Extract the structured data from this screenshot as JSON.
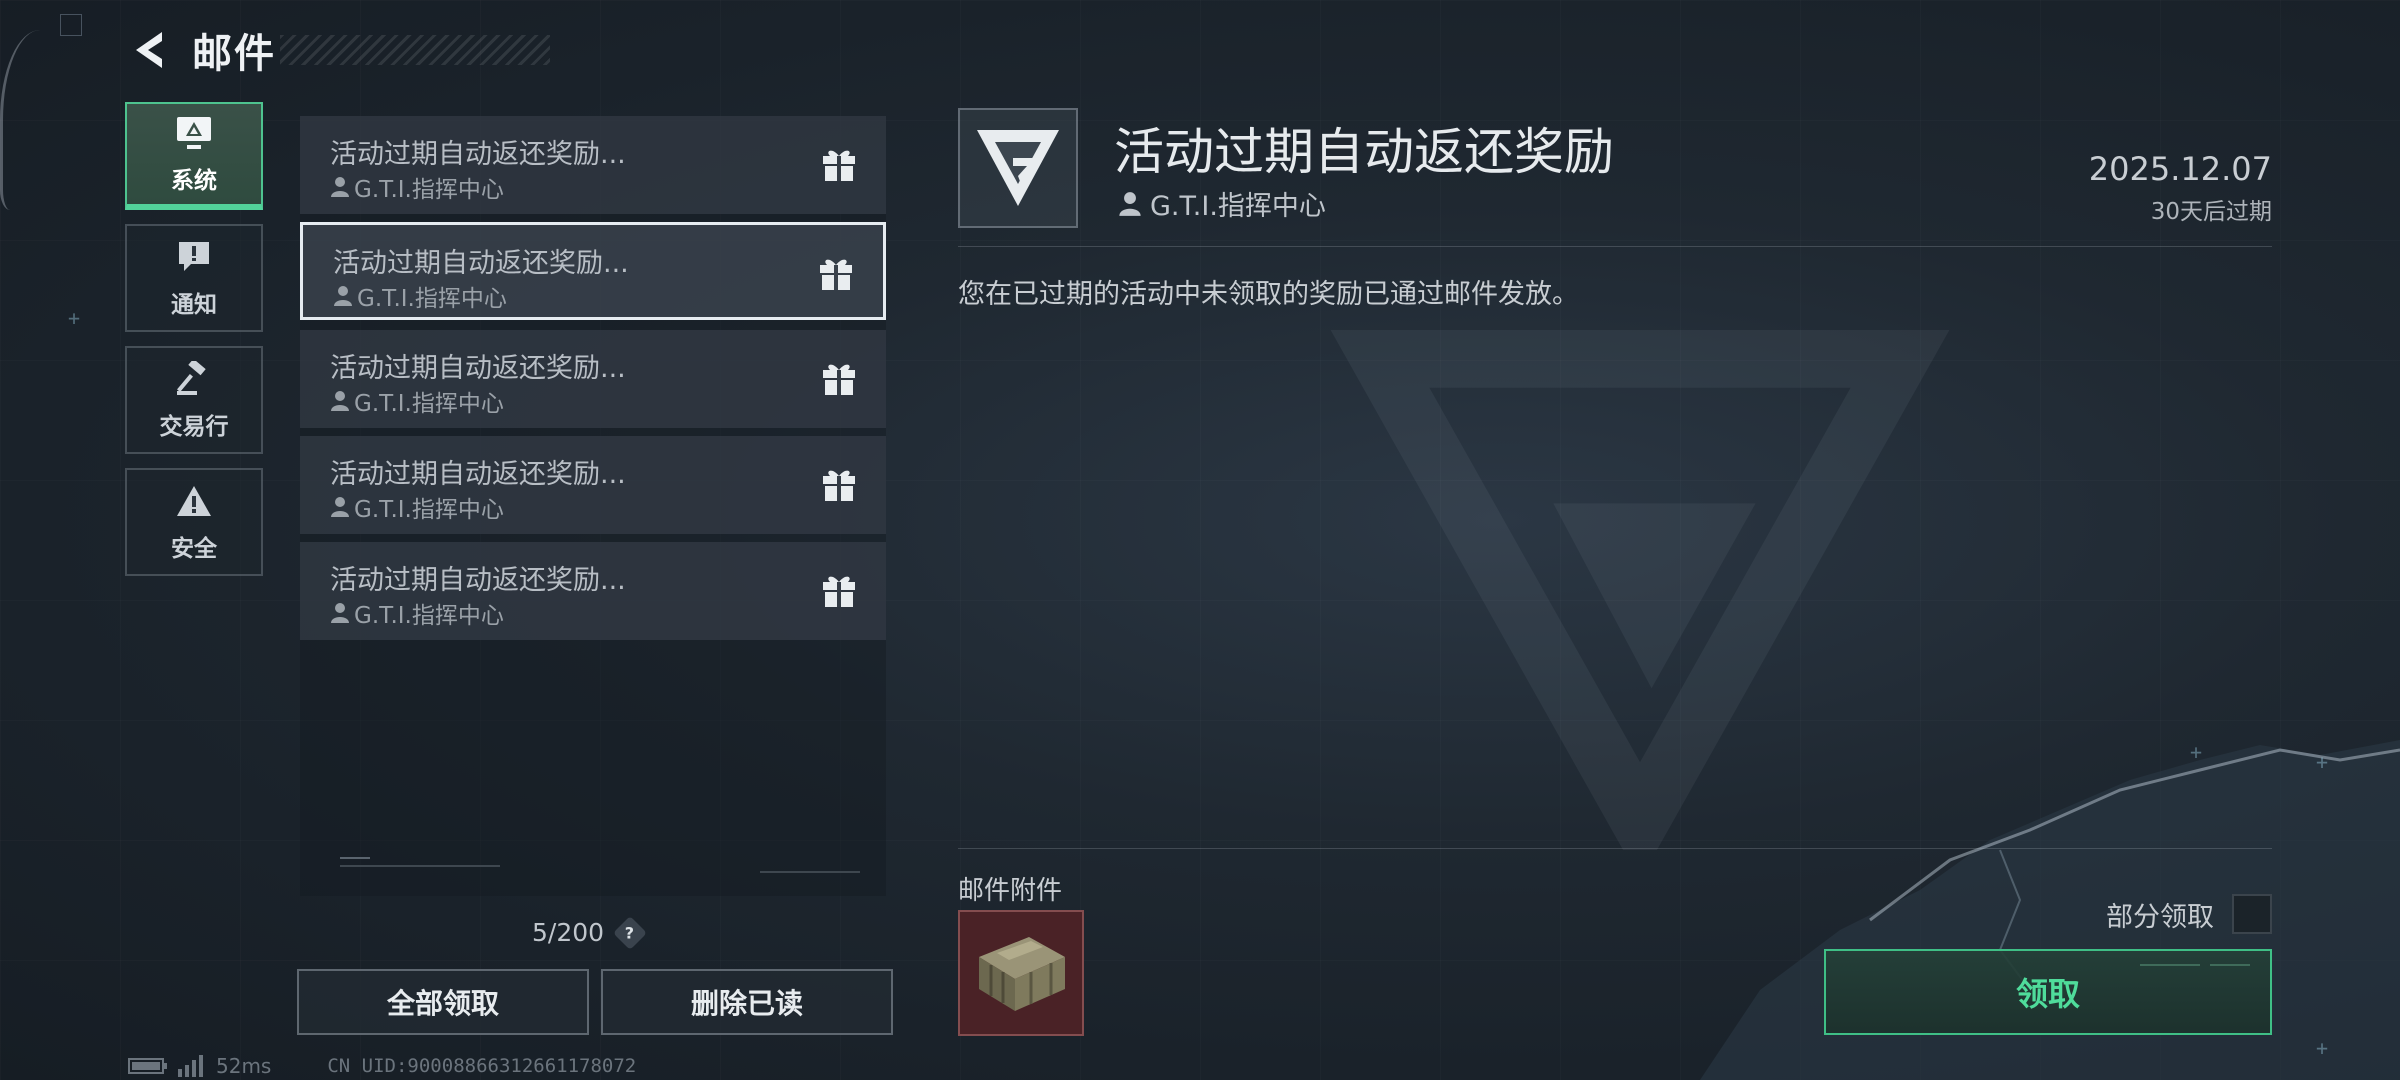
{
  "header": {
    "title": "邮件",
    "back_icon": "back-arrow-icon"
  },
  "categories": [
    {
      "label": "系统",
      "icon": "monitor-icon",
      "active": true
    },
    {
      "label": "通知",
      "icon": "alert-bubble-icon",
      "active": false
    },
    {
      "label": "交易行",
      "icon": "gavel-icon",
      "active": false
    },
    {
      "label": "安全",
      "icon": "warning-icon",
      "active": false
    }
  ],
  "mails": [
    {
      "subject": "活动过期自动返还奖励...",
      "sender": "G.T.I.指挥中心",
      "icon": "gift-icon",
      "selected": false
    },
    {
      "subject": "活动过期自动返还奖励...",
      "sender": "G.T.I.指挥中心",
      "icon": "gift-icon",
      "selected": true
    },
    {
      "subject": "活动过期自动返还奖励...",
      "sender": "G.T.I.指挥中心",
      "icon": "gift-icon",
      "selected": false
    },
    {
      "subject": "活动过期自动返还奖励...",
      "sender": "G.T.I.指挥中心",
      "icon": "gift-icon",
      "selected": false
    },
    {
      "subject": "活动过期自动返还奖励...",
      "sender": "G.T.I.指挥中心",
      "icon": "gift-icon",
      "selected": false
    }
  ],
  "mail_count": "5/200",
  "help_symbol": "?",
  "actions": {
    "claim_all": "全部领取",
    "delete_read": "删除已读"
  },
  "status": {
    "ping": "52ms",
    "uid": "CN UID:90008866312661178072"
  },
  "detail": {
    "title": "活动过期自动返还奖励",
    "sender": "G.T.I.指挥中心",
    "date": "2025.12.07",
    "expire": "30天后过期",
    "body": "您在已过期的活动中未领取的奖励已通过邮件发放。",
    "attachments_label": "邮件附件",
    "attachment_icon": "supply-crate-icon",
    "partial_claim_label": "部分领取",
    "partial_claim_checked": false,
    "claim_label": "领取"
  },
  "colors": {
    "accent": "#4fdc9b",
    "selected_border": "#e6ecf1",
    "attachment_bg": "#4a2226"
  }
}
